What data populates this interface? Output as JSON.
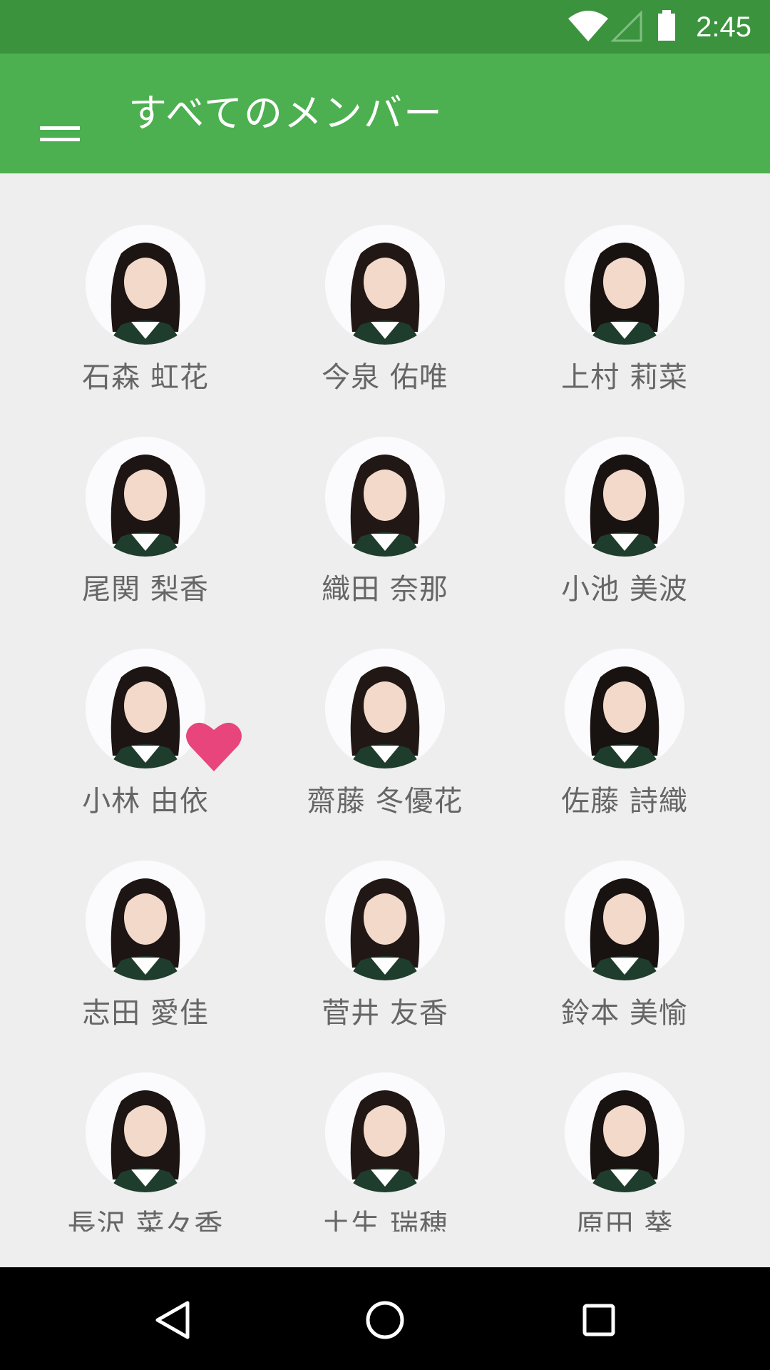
{
  "status_bar": {
    "time": "2:45",
    "icons": [
      "wifi-icon",
      "cell-signal-icon",
      "battery-icon"
    ]
  },
  "app_bar": {
    "title": "すべてのメンバー",
    "menu_icon": "hamburger-menu-icon"
  },
  "members": [
    {
      "name": "石森 虹花",
      "favorite": false
    },
    {
      "name": "今泉 佑唯",
      "favorite": false
    },
    {
      "name": "上村 莉菜",
      "favorite": false
    },
    {
      "name": "尾関 梨香",
      "favorite": false
    },
    {
      "name": "織田 奈那",
      "favorite": false
    },
    {
      "name": "小池 美波",
      "favorite": false
    },
    {
      "name": "小林 由依",
      "favorite": true
    },
    {
      "name": "齋藤 冬優花",
      "favorite": false
    },
    {
      "name": "佐藤 詩織",
      "favorite": false
    },
    {
      "name": "志田 愛佳",
      "favorite": false
    },
    {
      "name": "菅井 友香",
      "favorite": false
    },
    {
      "name": "鈴本 美愉",
      "favorite": false
    },
    {
      "name": "長沢 菜々香",
      "favorite": false
    },
    {
      "name": "土生 瑞穂",
      "favorite": false
    },
    {
      "name": "原田 葵",
      "favorite": false
    }
  ],
  "nav_bar": {
    "buttons": [
      "back-icon",
      "home-icon",
      "recents-icon"
    ]
  },
  "colors": {
    "status_bar": "#3c933e",
    "app_bar": "#4caf50",
    "background": "#eeeeee",
    "name_text": "#666666",
    "favorite_heart": "#e8457c",
    "nav_bar": "#000000"
  }
}
